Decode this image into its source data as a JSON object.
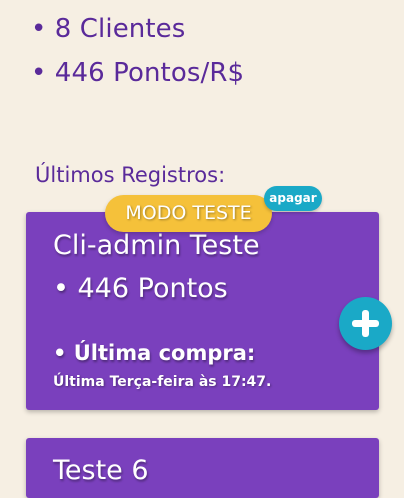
{
  "stats": {
    "clients": "• 8 Clientes",
    "points": "• 446 Pontos/R$"
  },
  "section_title": "Últimos Registros:",
  "mode_badge": "MODO TESTE",
  "delete_label": "apagar",
  "cards": [
    {
      "title": "Cli-admin Teste",
      "points": "• 446 Pontos",
      "last_purchase_label": "• Última compra:",
      "last_purchase_date": "Última Terça-feira às 17:47."
    },
    {
      "title": "Teste 6"
    }
  ],
  "icons": {
    "add": "plus-icon"
  },
  "colors": {
    "background": "#f6efe3",
    "accent_text": "#5a2a9a",
    "card": "#7a40bd",
    "badge_yellow": "#f5c13a",
    "teal": "#1aa9c7"
  }
}
